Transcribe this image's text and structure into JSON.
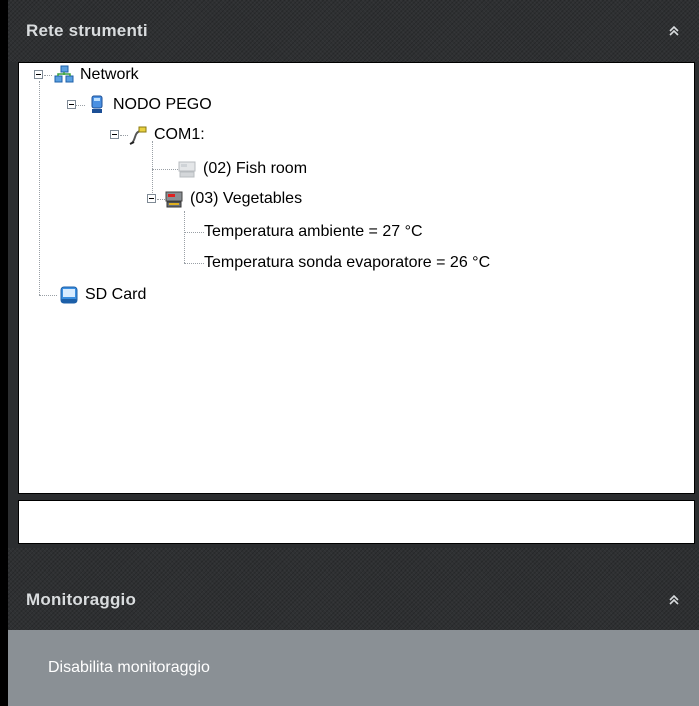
{
  "panels": {
    "network": {
      "title": "Rete strumenti"
    },
    "monitoring": {
      "title": "Monitoraggio",
      "toggle_button": "Disabilita monitoraggio"
    }
  },
  "tree": {
    "network": "Network",
    "node": "NODO PEGO",
    "port": "COM1:",
    "device_fish": "(02) Fish room",
    "device_veg": "(03) Vegetables",
    "temp_ambient": "Temperatura ambiente = 27 °C",
    "temp_probe": "Temperatura sonda evaporatore = 26 °C",
    "sdcard": "SD Card"
  },
  "search": {
    "value": ""
  },
  "icons": {
    "collapse_panel": "chevron-double-up-icon",
    "network": "network-icon",
    "node": "computer-node-icon",
    "port": "serial-cable-icon",
    "device_offline": "device-offline-icon",
    "device_online": "device-online-icon",
    "sdcard": "sd-card-icon"
  },
  "colors": {
    "header_bg": "#2e3032",
    "button_bg": "#8a9095",
    "title_text": "#d9dcde"
  }
}
